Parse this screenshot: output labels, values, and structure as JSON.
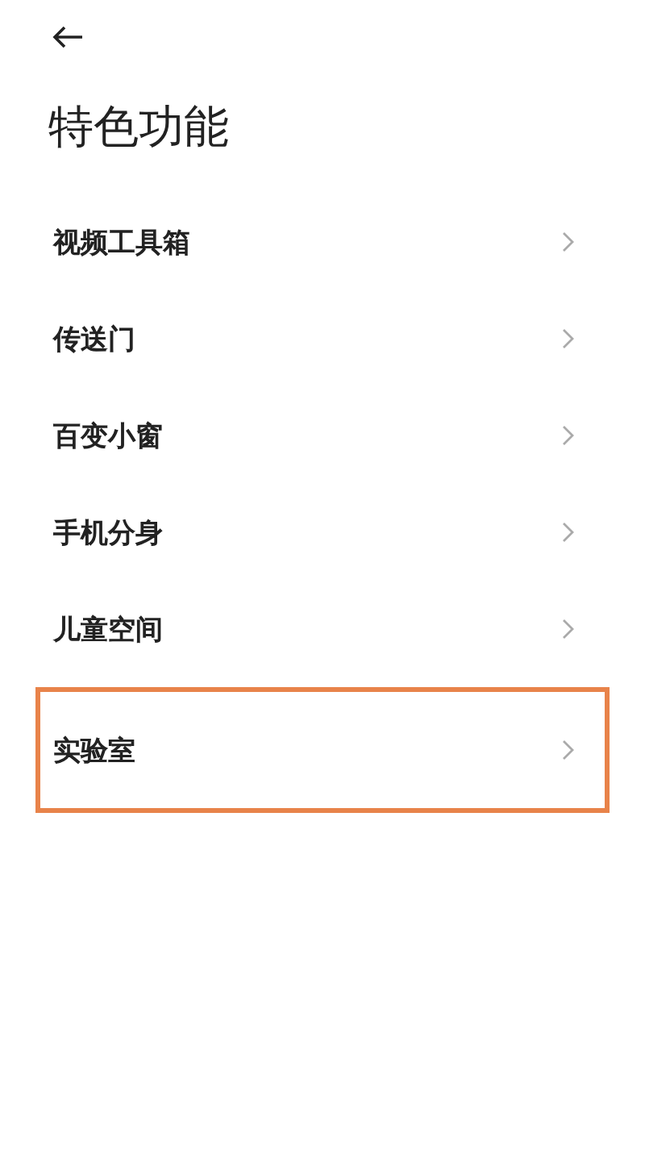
{
  "title": "特色功能",
  "items": [
    {
      "label": "视频工具箱",
      "highlighted": false
    },
    {
      "label": "传送门",
      "highlighted": false
    },
    {
      "label": "百变小窗",
      "highlighted": false
    },
    {
      "label": "手机分身",
      "highlighted": false
    },
    {
      "label": "儿童空间",
      "highlighted": false
    },
    {
      "label": "实验室",
      "highlighted": true
    }
  ]
}
